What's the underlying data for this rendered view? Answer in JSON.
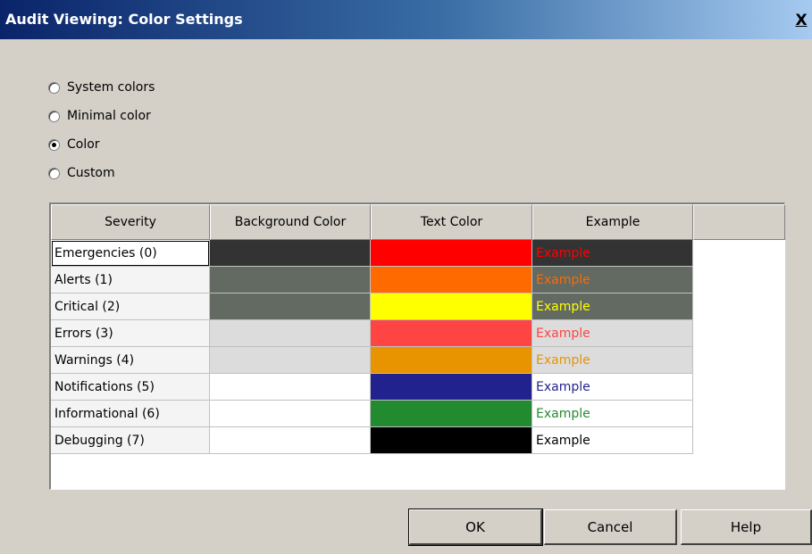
{
  "window": {
    "title": "Audit Viewing: Color Settings",
    "close_label": "X"
  },
  "options": [
    {
      "label": "System colors",
      "checked": false
    },
    {
      "label": "Minimal color",
      "checked": false
    },
    {
      "label": "Color",
      "checked": true
    },
    {
      "label": "Custom",
      "checked": false
    }
  ],
  "table": {
    "headers": [
      "Severity",
      "Background Color",
      "Text Color",
      "Example"
    ],
    "rows": [
      {
        "severity": "Emergencies (0)",
        "bg": "#333333",
        "text": "#ff0000",
        "example": "Example"
      },
      {
        "severity": "Alerts (1)",
        "bg": "#626a62",
        "text": "#ff6a00",
        "example": "Example"
      },
      {
        "severity": "Critical (2)",
        "bg": "#626a62",
        "text": "#ffff00",
        "example": "Example"
      },
      {
        "severity": "Errors (3)",
        "bg": "#dcdcdc",
        "text": "#ff4444",
        "example": "Example"
      },
      {
        "severity": "Warnings (4)",
        "bg": "#dcdcdc",
        "text": "#e89400",
        "example": "Example"
      },
      {
        "severity": "Notifications (5)",
        "bg": "#ffffff",
        "text": "#22228e",
        "example": "Example"
      },
      {
        "severity": "Informational (6)",
        "bg": "#ffffff",
        "text": "#228b30",
        "example": "Example"
      },
      {
        "severity": "Debugging (7)",
        "bg": "#ffffff",
        "text": "#000000",
        "example": "Example"
      }
    ]
  },
  "buttons": {
    "ok": "OK",
    "cancel": "Cancel",
    "help": "Help"
  }
}
